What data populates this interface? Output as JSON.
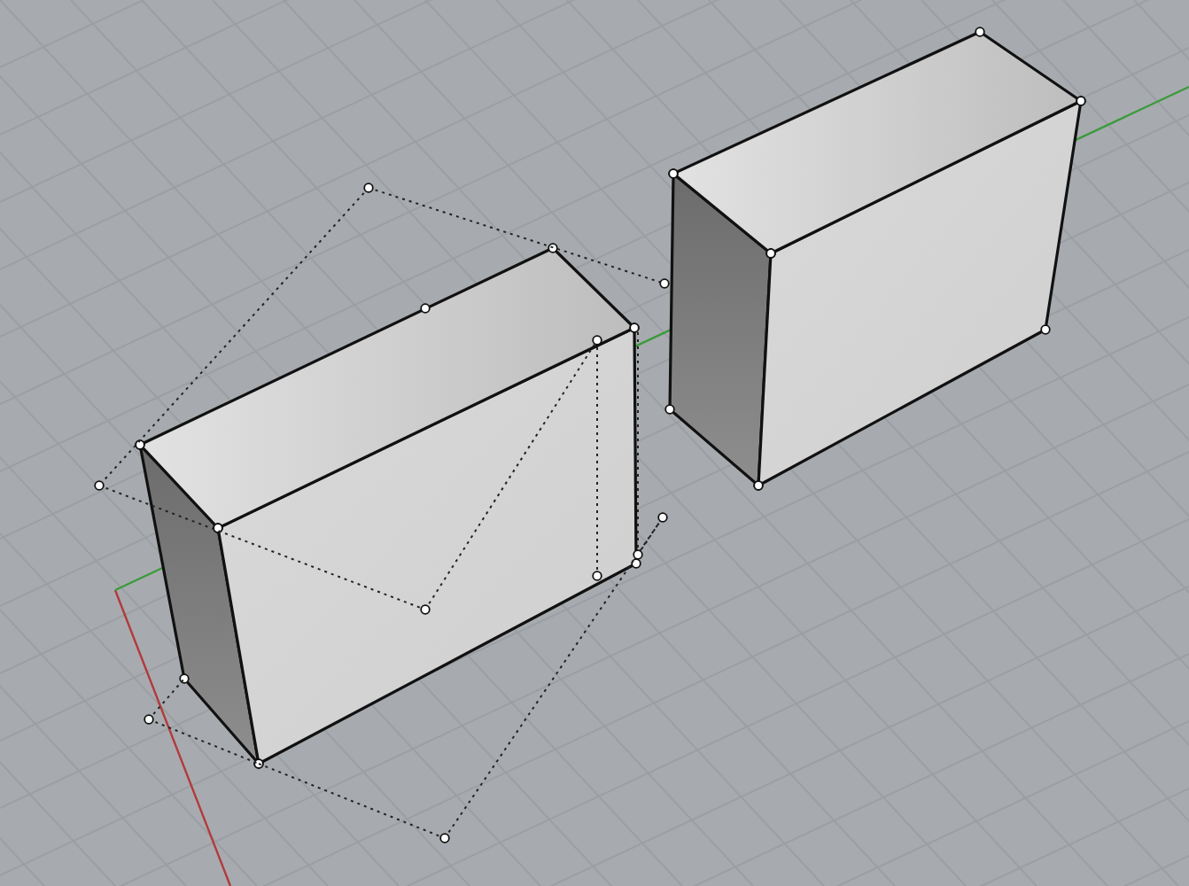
{
  "viewport": {
    "grid_visible": true,
    "axes_visible": true
  },
  "objects": [
    {
      "kind": "caged_box"
    },
    {
      "kind": "box"
    }
  ]
}
